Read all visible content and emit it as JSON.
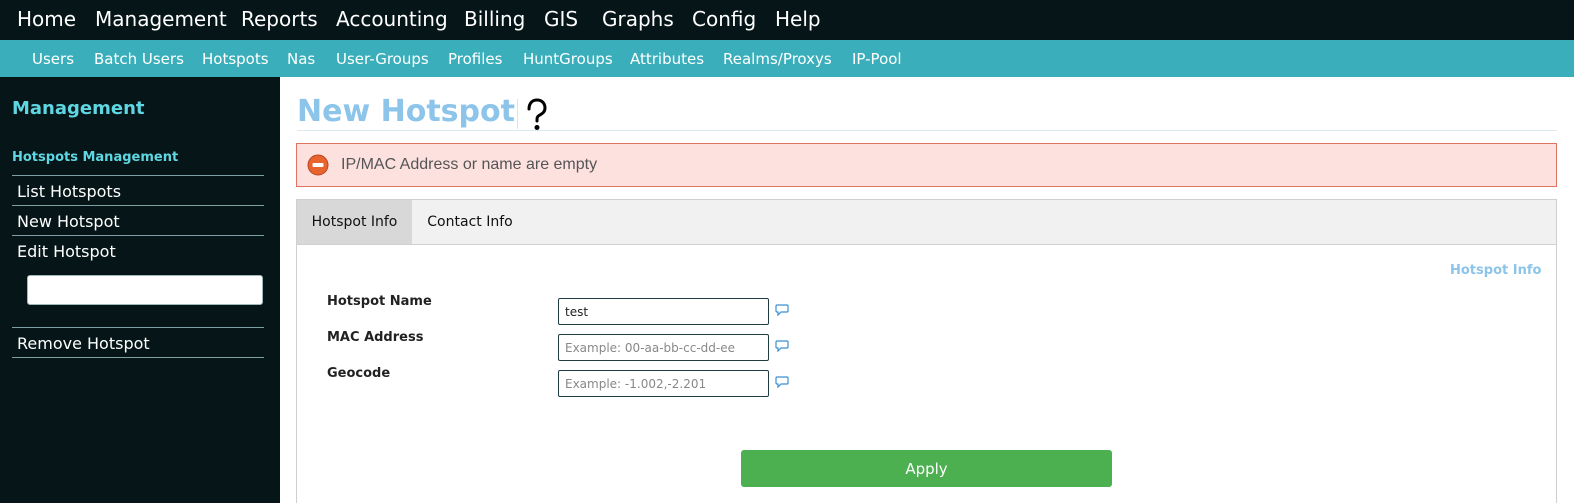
{
  "topnav": {
    "items": [
      "Home",
      "Management",
      "Reports",
      "Accounting",
      "Billing",
      "GIS",
      "Graphs",
      "Config",
      "Help"
    ]
  },
  "subnav": {
    "items": [
      "Users",
      "Batch Users",
      "Hotspots",
      "Nas",
      "User-Groups",
      "Profiles",
      "HuntGroups",
      "Attributes",
      "Realms/Proxys",
      "IP-Pool"
    ]
  },
  "sidebar": {
    "title": "Management",
    "section": "Hotspots Management",
    "links": {
      "list": "List Hotspots",
      "new": "New Hotspot",
      "edit": "Edit Hotspot",
      "remove": "Remove Hotspot"
    },
    "edit_input_value": ""
  },
  "main": {
    "title": "New Hotspot",
    "help_icon": "question-mark-icon",
    "alert": {
      "icon": "minus-circle-icon",
      "text": "IP/MAC Address or name are empty",
      "color": "#e07464"
    },
    "tabs": [
      "Hotspot Info",
      "Contact Info"
    ],
    "active_tab": "Hotspot Info",
    "legend": "Hotspot Info",
    "form": {
      "name_label": "Hotspot Name",
      "name_value": "test",
      "mac_label": "MAC Address",
      "mac_placeholder": "Example: 00-aa-bb-cc-dd-ee",
      "geo_label": "Geocode",
      "geo_placeholder": "Example: -1.002,-2.201",
      "tip_icon": "speech-bubble-icon"
    },
    "apply_label": "Apply",
    "apply_color": "#4caf50"
  }
}
